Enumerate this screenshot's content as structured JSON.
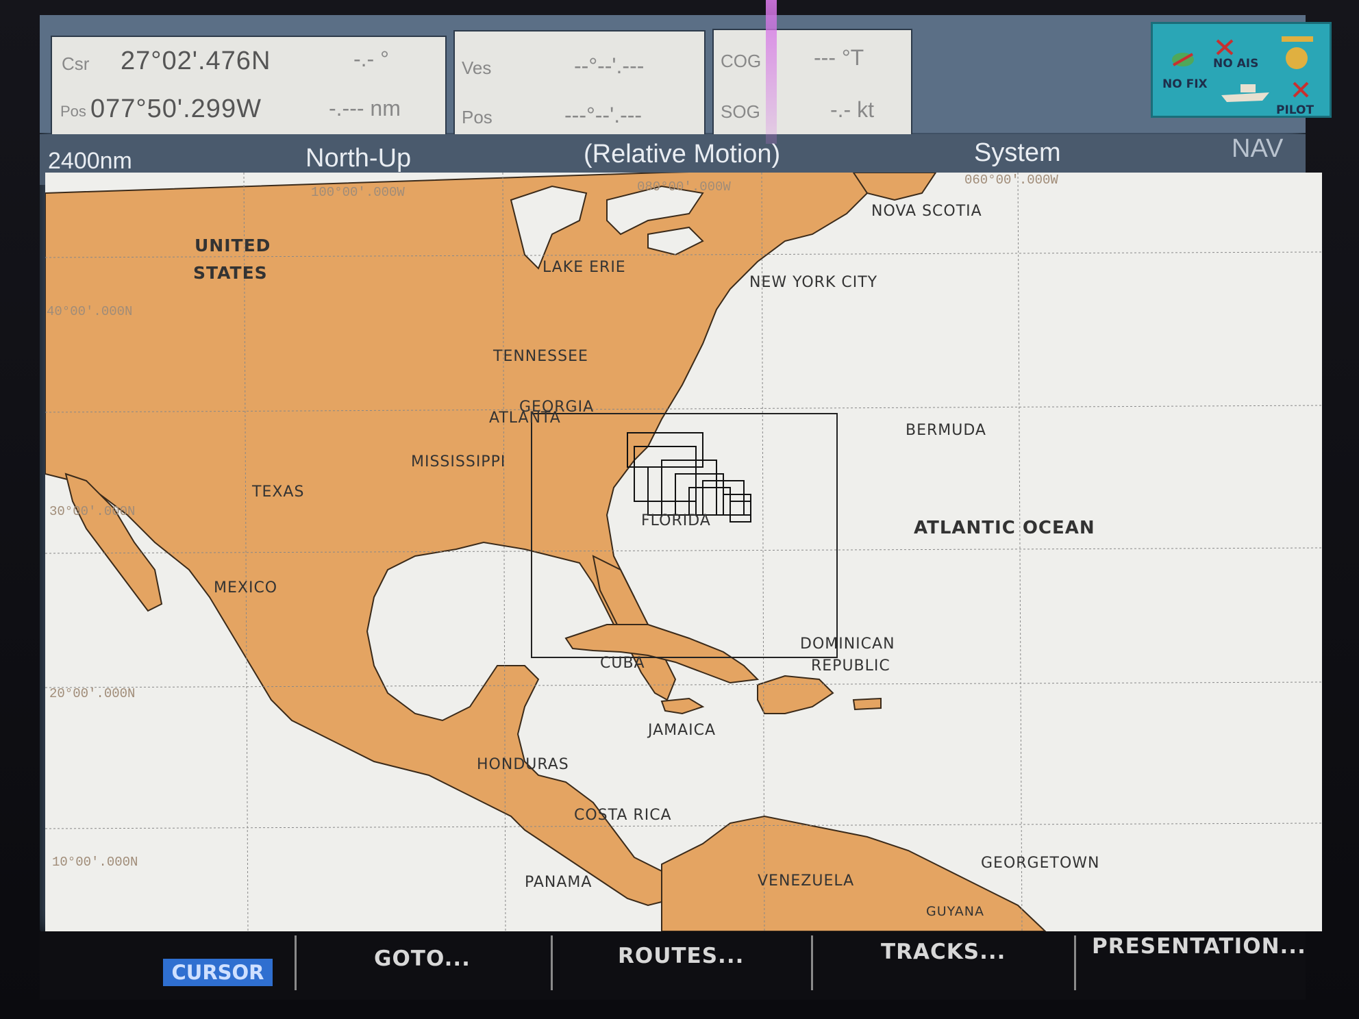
{
  "databar": {
    "csr_label": "Csr",
    "csr_lat": "27°02'.476N",
    "csr_bearing": "-.- °",
    "pos_label": "Pos",
    "csr_lon": "077°50'.299W",
    "csr_range": "-.--- nm",
    "ves_label": "Ves",
    "ves_value": "--°--'.---",
    "vpos_label": "Pos",
    "vpos_value": "---°--'.---",
    "cog_label": "COG",
    "cog_value": "--- °T",
    "sog_label": "SOG",
    "sog_value": "-.- kt"
  },
  "status": {
    "no_fix": "NO FIX",
    "no_ais": "NO AIS",
    "pilot": "PILOT"
  },
  "header": {
    "range": "2400nm",
    "orientation": "North-Up",
    "motion": "(Relative Motion)",
    "system": "System",
    "mode": "NAV"
  },
  "map": {
    "labels": {
      "united": "UNITED",
      "states": "STATES",
      "lake_erie": "LAKE ERIE",
      "nova_scotia": "NOVA SCOTIA",
      "new_york": "NEW YORK CITY",
      "tennessee": "TENNESSEE",
      "georgia": "GEORGIA",
      "atlanta": "ATLANTA",
      "mississippi": "MISSISSIPPI",
      "texas": "TEXAS",
      "bermuda": "BERMUDA",
      "florida": "FLORIDA",
      "atlantic": "ATLANTIC OCEAN",
      "mexico": "MEXICO",
      "dominican": "DOMINICAN",
      "republic": "REPUBLIC",
      "cuba": "CUBA",
      "jamaica": "JAMAICA",
      "honduras": "HONDURAS",
      "costa_rica": "COSTA RICA",
      "panama": "PANAMA",
      "venezuela": "VENEZUELA",
      "georgetown": "GEORGETOWN",
      "guyana": "GUYANA"
    },
    "grid": {
      "lon_100": "100°00'.000W",
      "lon_080": "080°00'.000W",
      "lon_060": "060°00'.000W",
      "lat_40": "40°00'.000N",
      "lat_30": "30°00'.000N",
      "lat_20": "20°00'.000N",
      "lat_10": "10°00'.000N"
    },
    "land_color": "#e4a462",
    "sea_color": "#efefec"
  },
  "softkeys": {
    "cursor": "CURSOR",
    "goto": "GOTO...",
    "routes": "ROUTES...",
    "tracks": "TRACKS...",
    "presentation": "PRESENTATION..."
  }
}
